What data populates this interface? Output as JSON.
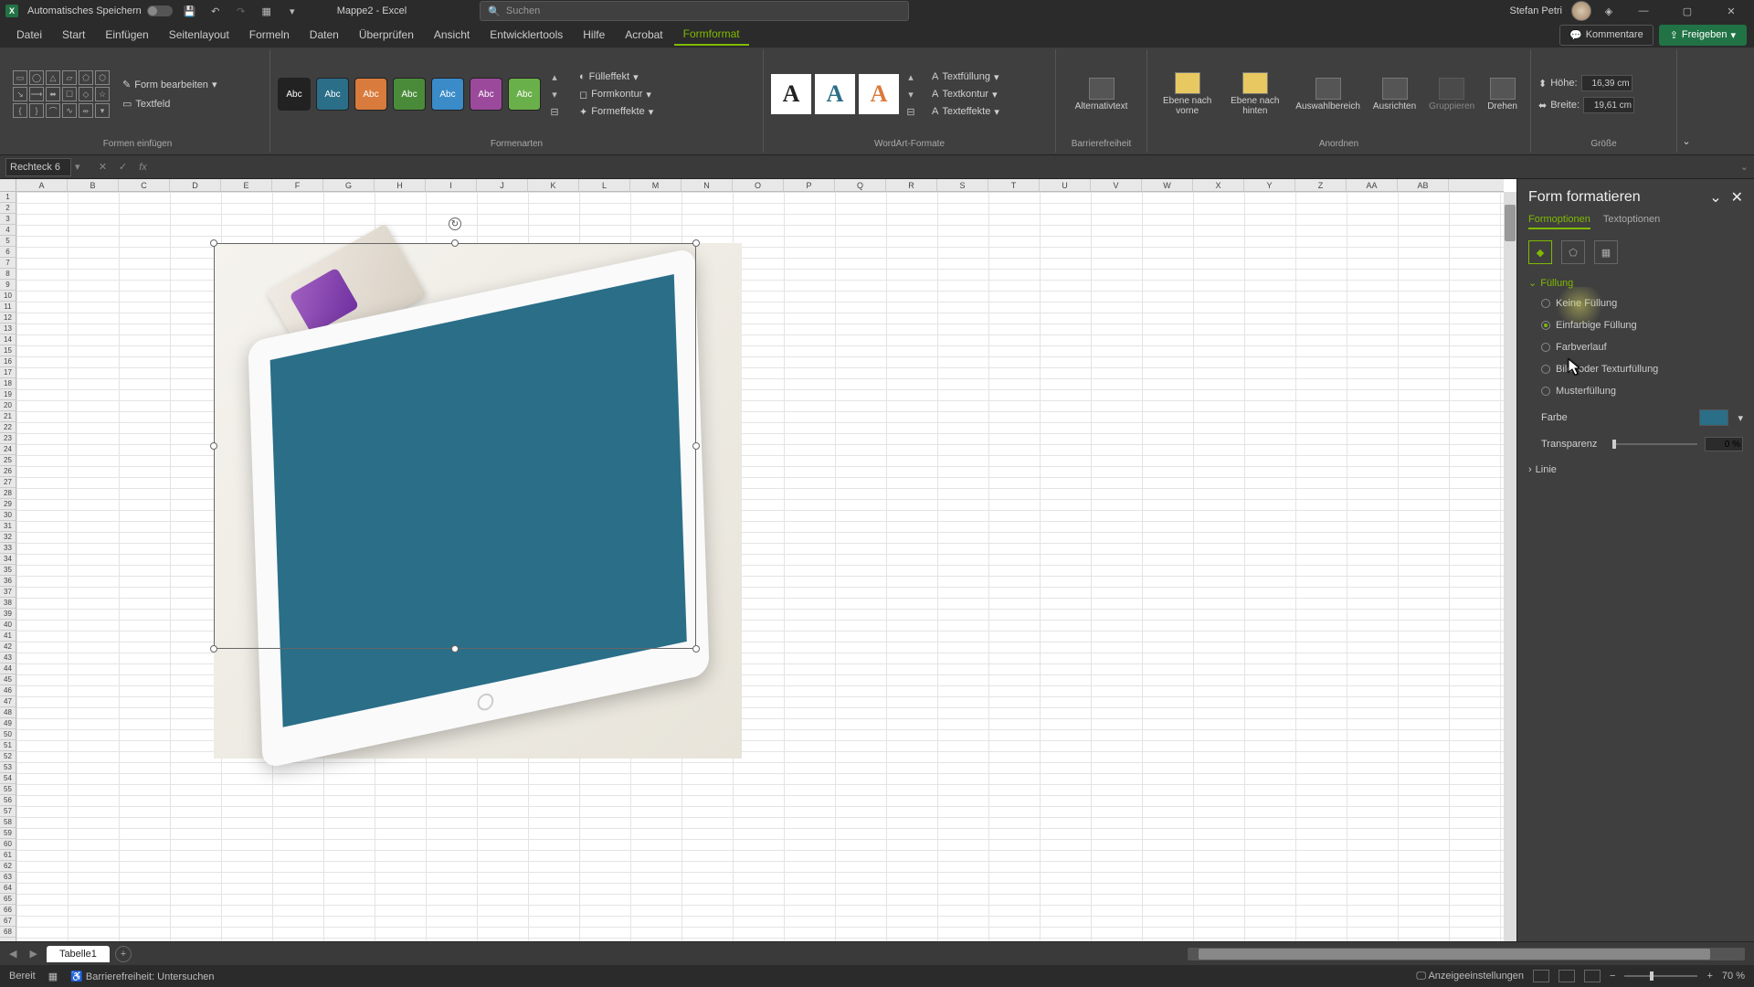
{
  "titlebar": {
    "autosave_label": "Automatisches Speichern",
    "title": "Mappe2 - Excel",
    "search_placeholder": "Suchen",
    "user": "Stefan Petri"
  },
  "menutabs": {
    "items": [
      "Datei",
      "Start",
      "Einfügen",
      "Seitenlayout",
      "Formeln",
      "Daten",
      "Überprüfen",
      "Ansicht",
      "Entwicklertools",
      "Hilfe",
      "Acrobat",
      "Formformat"
    ],
    "active_index": 11,
    "comments": "Kommentare",
    "share": "Freigeben"
  },
  "ribbon": {
    "groups": {
      "insert_shapes": {
        "label": "Formen einfügen",
        "edit_shape": "Form bearbeiten",
        "textfield": "Textfeld"
      },
      "shape_styles": {
        "label": "Formenarten",
        "swatch_text": "Abc",
        "fill": "Fülleffekt",
        "outline": "Formkontur",
        "effects": "Formeffekte"
      },
      "wordart": {
        "label": "WordArt-Formate",
        "textfill": "Textfüllung",
        "textoutline": "Textkontur",
        "texteffects": "Texteffekte"
      },
      "alt": {
        "label": "Barrierefreiheit",
        "btn": "Alternativtext"
      },
      "arrange": {
        "label": "Anordnen",
        "front": "Ebene nach vorne",
        "back": "Ebene nach hinten",
        "selection": "Auswahlbereich",
        "align": "Ausrichten",
        "group": "Gruppieren",
        "rotate": "Drehen"
      },
      "size": {
        "label": "Größe",
        "height_lbl": "Höhe:",
        "width_lbl": "Breite:",
        "height": "16,39 cm",
        "width": "19,61 cm"
      }
    }
  },
  "formula": {
    "namebox": "Rechteck 6"
  },
  "columns": [
    "A",
    "B",
    "C",
    "D",
    "E",
    "F",
    "G",
    "H",
    "I",
    "J",
    "K",
    "L",
    "M",
    "N",
    "O",
    "P",
    "Q",
    "R",
    "S",
    "T",
    "U",
    "V",
    "W",
    "X",
    "Y",
    "Z",
    "AA",
    "AB"
  ],
  "sidepanel": {
    "title": "Form formatieren",
    "tabs": {
      "shape": "Formoptionen",
      "text": "Textoptionen"
    },
    "fill": {
      "header": "Füllung",
      "options": {
        "none": "Keine Füllung",
        "solid": "Einfarbige Füllung",
        "gradient": "Farbverlauf",
        "picture": "Bild- oder Texturfüllung",
        "pattern": "Musterfüllung"
      },
      "selected": "solid",
      "color_label": "Farbe",
      "transparency_label": "Transparenz",
      "transparency_value": "0 %"
    },
    "line": {
      "header": "Linie"
    }
  },
  "sheettabs": {
    "sheet1": "Tabelle1"
  },
  "statusbar": {
    "ready": "Bereit",
    "accessibility": "Barrierefreiheit: Untersuchen",
    "display_settings": "Anzeigeeinstellungen",
    "zoom": "70 %"
  },
  "style_colors": [
    "#222",
    "#2a6e88",
    "#d97b3c",
    "#4a8b3a",
    "#3a8bc8",
    "#9b4a9b",
    "#6ab04a"
  ]
}
